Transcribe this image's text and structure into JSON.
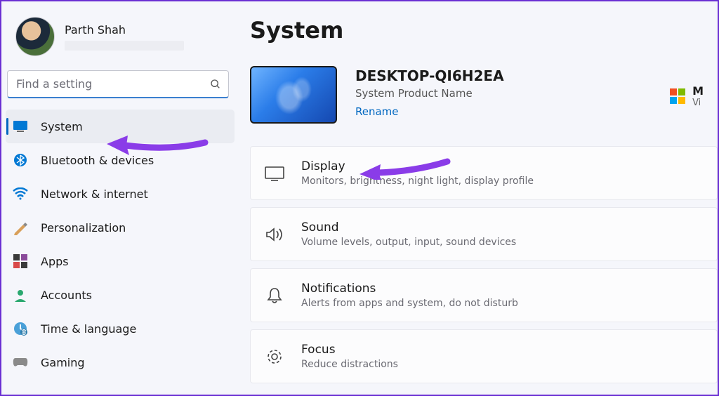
{
  "user": {
    "name": "Parth Shah"
  },
  "search": {
    "placeholder": "Find a setting"
  },
  "sidebar": {
    "items": [
      {
        "label": "System"
      },
      {
        "label": "Bluetooth & devices"
      },
      {
        "label": "Network & internet"
      },
      {
        "label": "Personalization"
      },
      {
        "label": "Apps"
      },
      {
        "label": "Accounts"
      },
      {
        "label": "Time & language"
      },
      {
        "label": "Gaming"
      }
    ]
  },
  "page": {
    "title": "System"
  },
  "device": {
    "name": "DESKTOP-QI6H2EA",
    "product": "System Product Name",
    "rename": "Rename"
  },
  "ms": {
    "title": "M",
    "sub": "Vi"
  },
  "cards": [
    {
      "title": "Display",
      "desc": "Monitors, brightness, night light, display profile"
    },
    {
      "title": "Sound",
      "desc": "Volume levels, output, input, sound devices"
    },
    {
      "title": "Notifications",
      "desc": "Alerts from apps and system, do not disturb"
    },
    {
      "title": "Focus",
      "desc": "Reduce distractions"
    }
  ]
}
